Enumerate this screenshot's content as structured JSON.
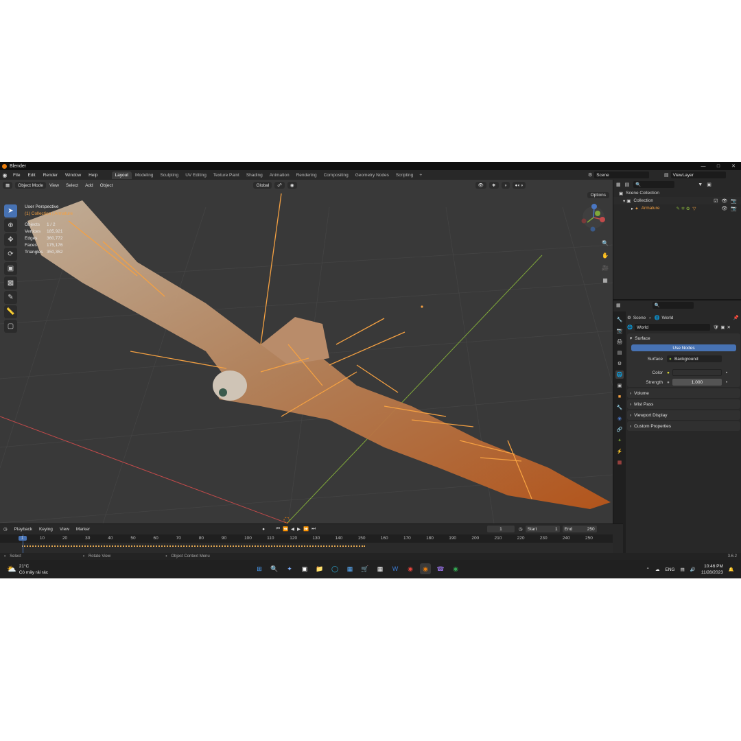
{
  "app": {
    "title": "Blender",
    "version": "3.6.2"
  },
  "menu": [
    "File",
    "Edit",
    "Render",
    "Window",
    "Help"
  ],
  "workspaces": [
    "Layout",
    "Modeling",
    "Sculpting",
    "UV Editing",
    "Texture Paint",
    "Shading",
    "Animation",
    "Rendering",
    "Compositing",
    "Geometry Nodes",
    "Scripting"
  ],
  "active_workspace": "Layout",
  "scene": "Scene",
  "view_layer": "ViewLayer",
  "viewport": {
    "mode": "Object Mode",
    "menu": [
      "View",
      "Select",
      "Add",
      "Object"
    ],
    "orientation": "Global",
    "options_label": "Options",
    "perspective": "User Perspective",
    "context": "(1) Collection | Armature",
    "stats": [
      {
        "label": "Objects",
        "value": "1 / 2"
      },
      {
        "label": "Vertices",
        "value": "185,921"
      },
      {
        "label": "Edges",
        "value": "360,772"
      },
      {
        "label": "Faces",
        "value": "175,176"
      },
      {
        "label": "Triangles",
        "value": "350,352"
      }
    ]
  },
  "outliner": {
    "rows": [
      {
        "label": "Scene Collection",
        "icon": "collection-icon"
      },
      {
        "label": "Collection",
        "icon": "collection-icon"
      },
      {
        "label": "Armature",
        "icon": "armature-icon"
      }
    ]
  },
  "properties": {
    "breadcrumb": [
      "Scene",
      "World"
    ],
    "world_name": "World",
    "surface_panel": "Surface",
    "use_nodes": "Use Nodes",
    "surface_label": "Surface",
    "surface_value": "Background",
    "color_label": "Color",
    "strength_label": "Strength",
    "strength_value": "1.000",
    "collapsed_panels": [
      "Volume",
      "Mist Pass",
      "Viewport Display",
      "Custom Properties"
    ]
  },
  "timeline": {
    "menu": [
      "Playback",
      "Keying",
      "View",
      "Marker"
    ],
    "current_frame": "1",
    "start_label": "Start",
    "start": "1",
    "end_label": "End",
    "end": "250",
    "ruler": [
      "1",
      "10",
      "20",
      "30",
      "40",
      "50",
      "60",
      "70",
      "80",
      "90",
      "100",
      "110",
      "120",
      "130",
      "140",
      "150",
      "160",
      "170",
      "180",
      "190",
      "200",
      "210",
      "220",
      "230",
      "240",
      "250"
    ]
  },
  "status": [
    "Select",
    "Rotate View",
    "Object Context Menu"
  ],
  "taskbar": {
    "temperature": "21°C",
    "weather_text": "Có mây rải rác",
    "language": "ENG",
    "time": "10:46 PM",
    "date": "11/28/2023"
  },
  "colors": {
    "accent_blue": "#4772b3",
    "armature_orange": "#f5a142",
    "x_axis": "#c24a4a",
    "y_axis": "#7fa83a"
  }
}
